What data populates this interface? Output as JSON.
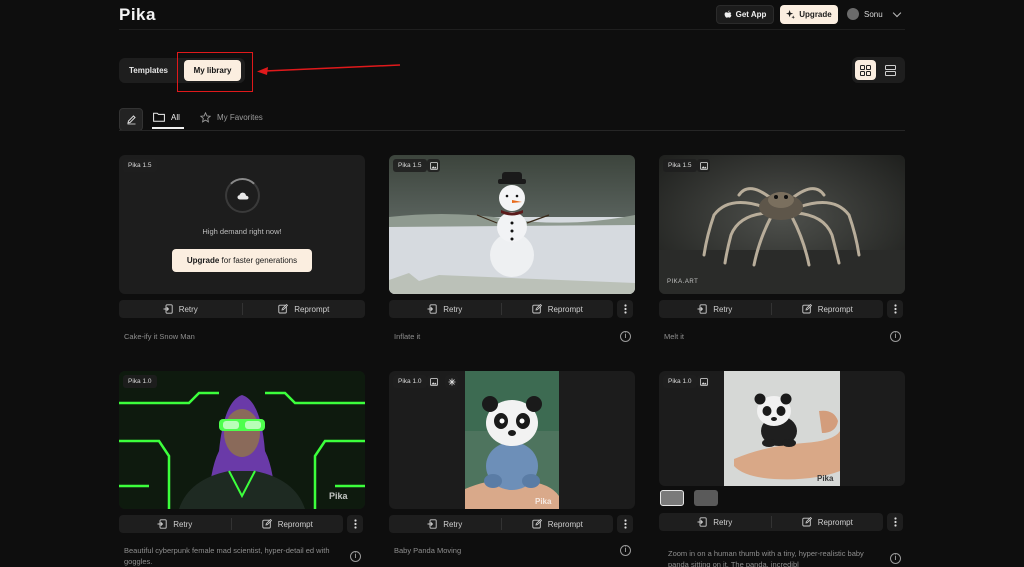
{
  "header": {
    "logo": "Pika",
    "get_app": "Get App",
    "upgrade": "Upgrade",
    "user_name": "Sonu"
  },
  "tabs": {
    "templates": "Templates",
    "my_library": "My library"
  },
  "filters": {
    "all": "All",
    "favorites": "My Favorites"
  },
  "card_actions": {
    "retry": "Retry",
    "reprompt": "Reprompt"
  },
  "cards": [
    {
      "version": "Pika 1.5",
      "prompt": "Cake-ify it Snow Man",
      "status": "High demand right now!",
      "upgrade_strong": "Upgrade",
      "upgrade_rest": " for faster generations"
    },
    {
      "version": "Pika 1.5",
      "prompt": "Inflate it"
    },
    {
      "version": "Pika 1.5",
      "prompt": "Melt it",
      "watermark": "PIKA.ART"
    },
    {
      "version": "Pika 1.0",
      "prompt": "Beautiful cyberpunk female mad scientist, hyper-detail ed with goggles.",
      "watermark": "Pika"
    },
    {
      "version": "Pika 1.0",
      "prompt": "Baby Panda Moving",
      "watermark": "Pika"
    },
    {
      "version": "Pika 1.0",
      "prompt": "Zoom in on a human thumb with a tiny, hyper-realistic baby panda sitting on it. The panda, incredibl",
      "watermark": "Pika"
    }
  ],
  "colors": {
    "accent": "#fbeee0",
    "highlight": "#e0191b",
    "background": "#0e0e0e"
  }
}
